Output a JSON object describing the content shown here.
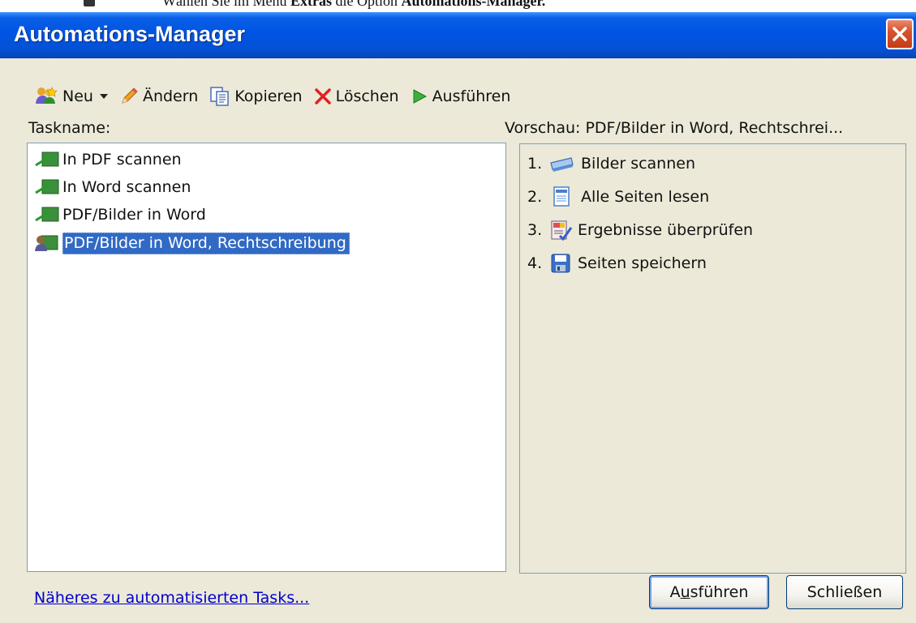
{
  "document": {
    "text_prefix": "Wählen Sie im Menü ",
    "text_bold1": "Extras",
    "text_mid": " die Option ",
    "text_bold2": "Automations-Manager."
  },
  "window": {
    "title": "Automations-Manager"
  },
  "toolbar": {
    "new_label": "Neu",
    "edit_label": "Ändern",
    "copy_label": "Kopieren",
    "delete_label": "Löschen",
    "run_label": "Ausführen"
  },
  "tasks": {
    "header": "Taskname:",
    "items": [
      {
        "label": "In PDF scannen",
        "icon": "task-arrow-icon"
      },
      {
        "label": "In Word scannen",
        "icon": "task-arrow-icon"
      },
      {
        "label": "PDF/Bilder in Word",
        "icon": "task-arrow-icon"
      },
      {
        "label": "PDF/Bilder in Word, Rechtschreibung",
        "icon": "custom-task-icon",
        "selected": true
      }
    ]
  },
  "preview": {
    "header": "Vorschau: PDF/Bilder in Word, Rechtschrei...",
    "steps": [
      {
        "num": "1.",
        "label": "Bilder scannen",
        "icon": "scanner-icon"
      },
      {
        "num": "2.",
        "label": "Alle Seiten lesen",
        "icon": "page-icon"
      },
      {
        "num": "3.",
        "label": "Ergebnisse überprüfen",
        "icon": "verify-icon"
      },
      {
        "num": "4.",
        "label": "Seiten speichern",
        "icon": "floppy-disk-icon"
      }
    ]
  },
  "footer": {
    "help_link": "Näheres zu automatisierten Tasks...",
    "run_button_pre": "A",
    "run_button_u": "u",
    "run_button_post": "sführen",
    "close_button": "Schließen"
  }
}
